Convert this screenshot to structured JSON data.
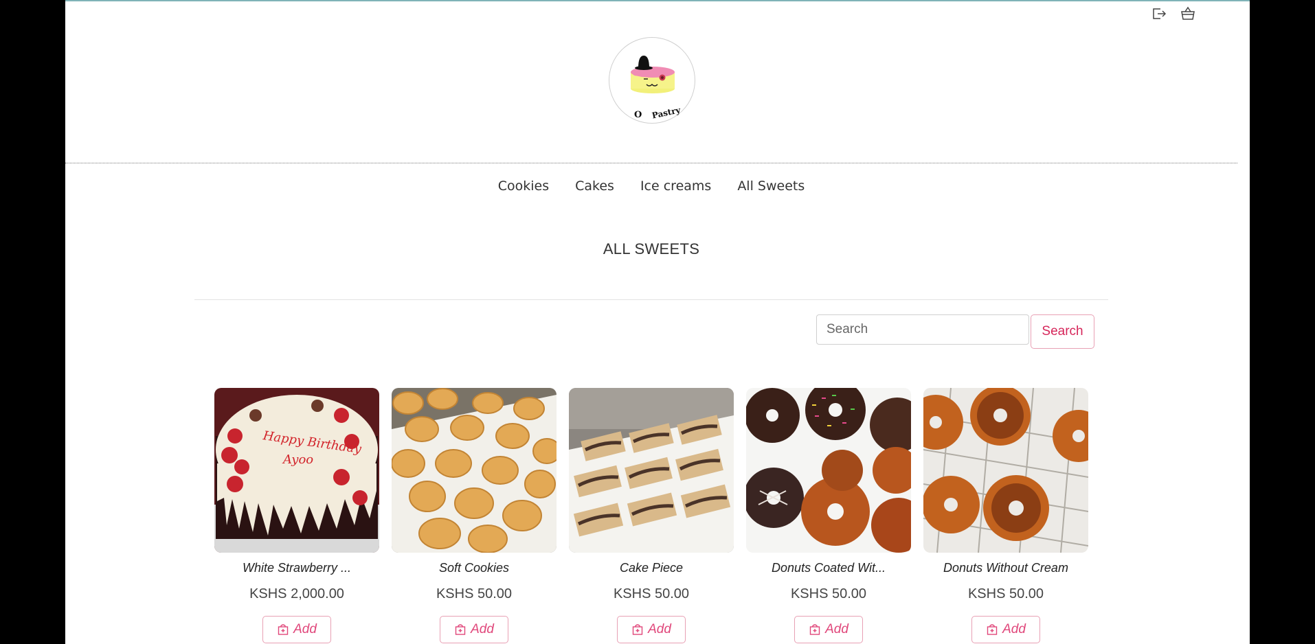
{
  "logo": {
    "text_left": "O",
    "text_right": "Pastry"
  },
  "header_icons": [
    "logout-icon",
    "basket-icon"
  ],
  "nav": {
    "items": [
      "Cookies",
      "Cakes",
      "Ice creams",
      "All Sweets"
    ]
  },
  "page_title": "ALL SWEETS",
  "search": {
    "placeholder": "Search",
    "button_label": "Search"
  },
  "products": [
    {
      "name": "White Strawberry ...",
      "price": "KSHS 2,000.00",
      "add_label": "Add"
    },
    {
      "name": "Soft Cookies",
      "price": "KSHS 50.00",
      "add_label": "Add"
    },
    {
      "name": "Cake Piece",
      "price": "KSHS 50.00",
      "add_label": "Add"
    },
    {
      "name": "Donuts Coated Wit...",
      "price": "KSHS 50.00",
      "add_label": "Add"
    },
    {
      "name": "Donuts Without Cream",
      "price": "KSHS 50.00",
      "add_label": "Add"
    }
  ],
  "colors": {
    "accent": "#d6265a",
    "accent_border": "#e8a0b4"
  }
}
